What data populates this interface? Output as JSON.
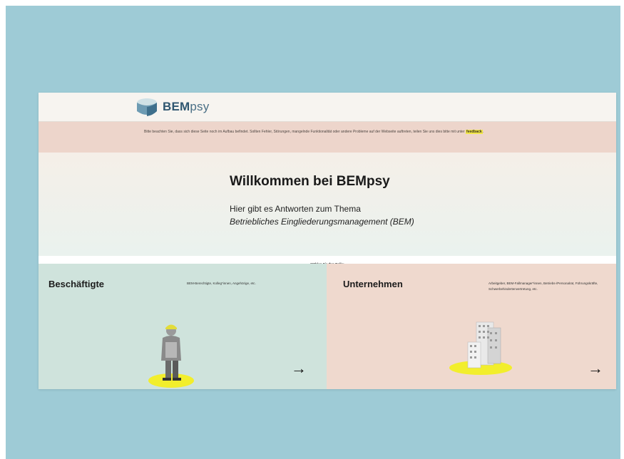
{
  "header": {
    "logo_bold": "BEM",
    "logo_light": "psy"
  },
  "notice": {
    "text": "Bitte beachten Sie, dass sich diese Seite noch im Aufbau befindet. Sollten Fehler, Störungen, mangelnde Funktionalität oder andere Probleme auf der Webseite auftreten, teilen Sie uns dies bitte mit unter",
    "link": "feedback",
    "end": "."
  },
  "hero": {
    "title": "Willkommen bei BEMpsy",
    "subtitle": "Hier gibt es Antworten zum Thema",
    "subtitle_italic": "Betriebliches Eingliederungsmanagement (BEM)"
  },
  "role_prompt": "Wählen Sie Ihre Rolle:",
  "cards": [
    {
      "title": "Beschäftigte",
      "description": "BEM-Berechtigte, Kolleg*innen, Angehörige, etc.",
      "arrow": "→",
      "icon": "worker-illustration"
    },
    {
      "title": "Unternehmen",
      "description": "Arbeitgeber, BEM-Fallmanager*innen, Betriebs-/Personalrat, Führungskräfte, Schwerbehindertenvertretung, etc.",
      "arrow": "→",
      "icon": "office-buildings-illustration"
    }
  ],
  "colors": {
    "outer_background": "#9ecbd6",
    "notice_background": "#edd5cb",
    "card_left": "#cfe3dc",
    "card_right": "#efd9ce",
    "highlight": "#f0e64a"
  }
}
